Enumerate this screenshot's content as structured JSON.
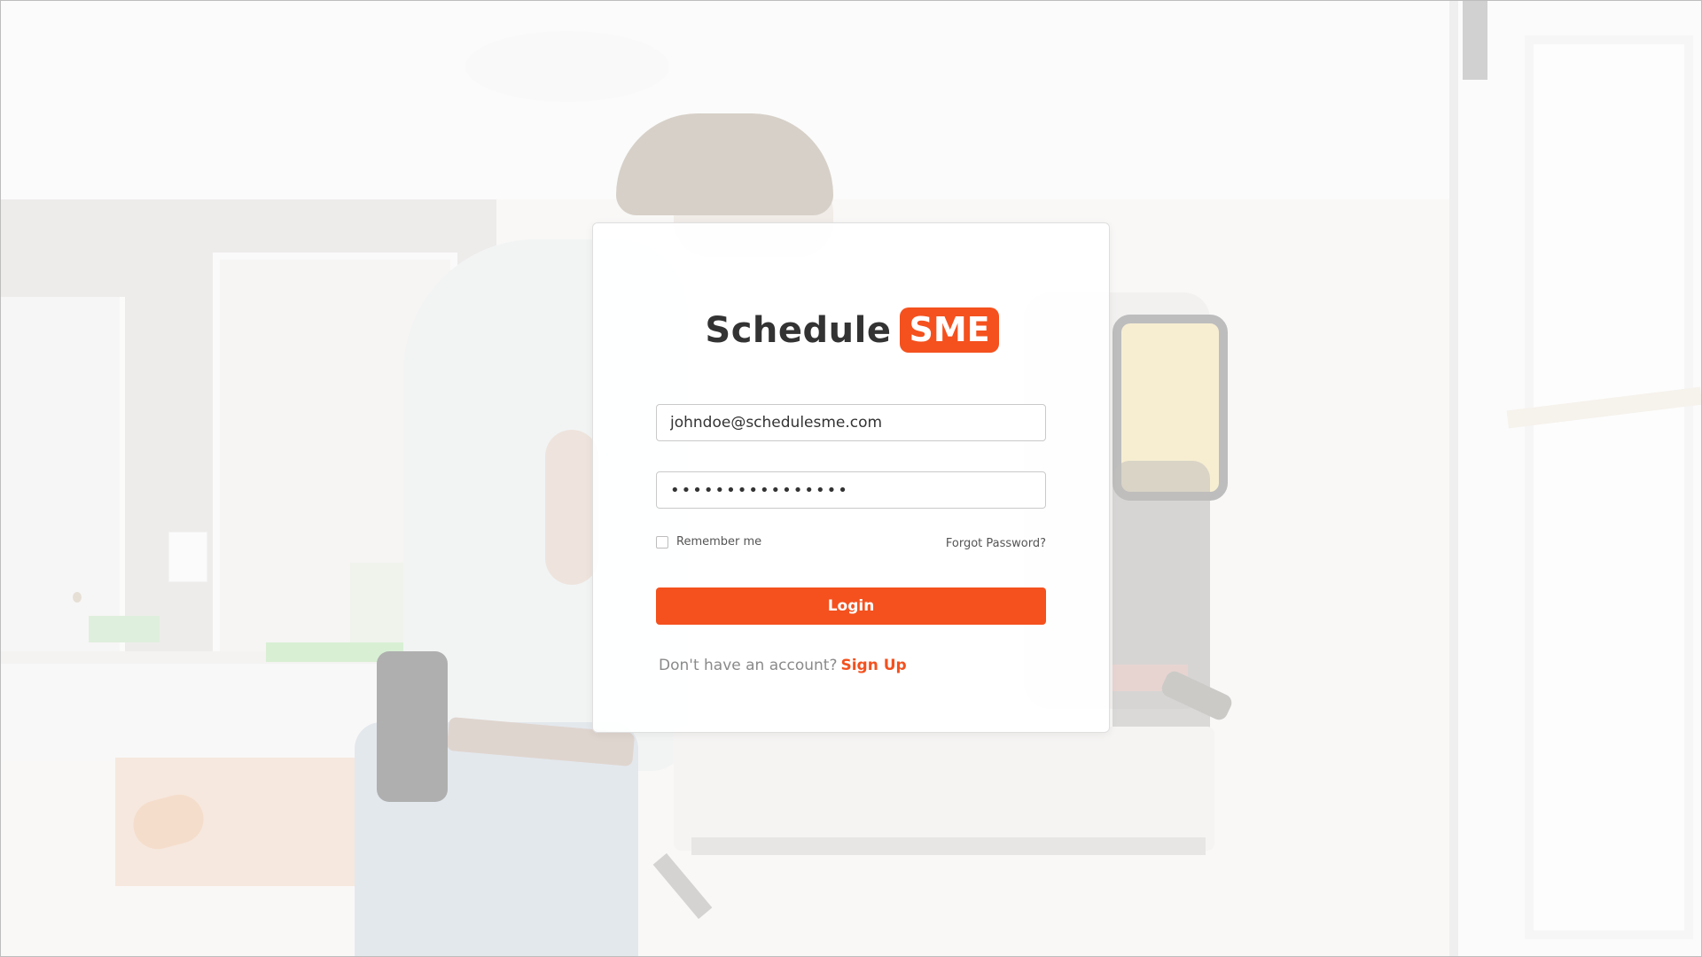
{
  "brand": {
    "name": "Schedule",
    "badge": "SME",
    "accent_color": "#f4511e"
  },
  "login_form": {
    "email_value": "johndoe@schedulesme.com",
    "password_value": "••••••••••••••••",
    "remember_label": "Remember me",
    "remember_checked": false,
    "forgot_label": "Forgot Password?",
    "login_label": "Login",
    "no_account_text": "Don't have an account?",
    "signup_label": "Sign Up"
  }
}
